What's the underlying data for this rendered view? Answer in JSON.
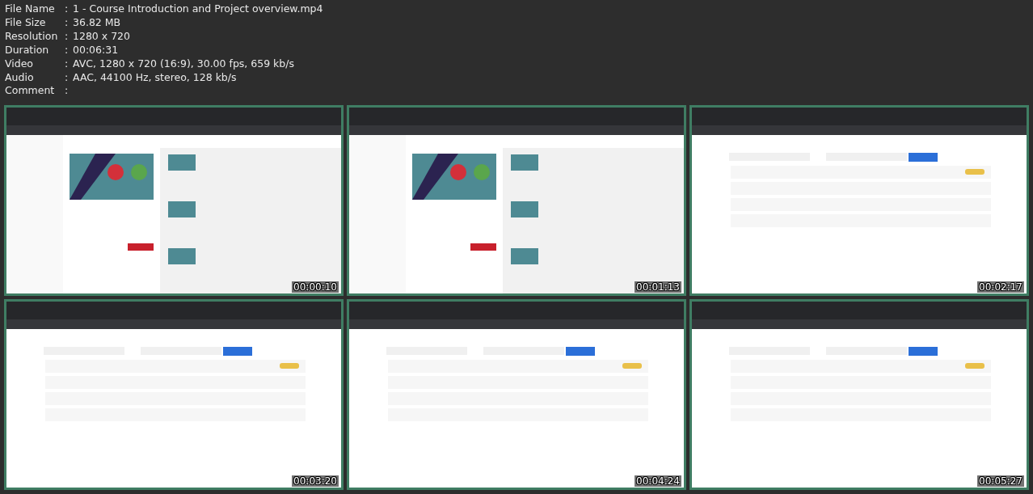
{
  "file_info": [
    {
      "label": "File Name",
      "separator": ":",
      "value": "1 - Course Introduction and Project overview.mp4"
    },
    {
      "label": "File Size",
      "separator": ":",
      "value": "36.82 MB"
    },
    {
      "label": "Resolution",
      "separator": ":",
      "value": "1280 x 720"
    },
    {
      "label": "Duration",
      "separator": ":",
      "value": "00:06:31"
    },
    {
      "label": "Video",
      "separator": ":",
      "value": "AVC, 1280 x 720 (16:9), 30.00 fps, 659 kb/s"
    },
    {
      "label": "Audio",
      "separator": ":",
      "value": "AAC, 44100 Hz, stereo, 128 kb/s"
    },
    {
      "label": "Comment",
      "separator": ":"
    }
  ],
  "thumbnails": [
    {
      "kind": "picture",
      "timestamp": "00:00:10"
    },
    {
      "kind": "picture",
      "timestamp": "00:01:13"
    },
    {
      "kind": "picture",
      "timestamp": "00:02:17"
    },
    {
      "kind": "picture",
      "timestamp": "00:03:20"
    },
    {
      "kind": "picture",
      "timestamp": "00:04:24"
    },
    {
      "kind": "picture",
      "timestamp": "00:05:27"
    }
  ]
}
